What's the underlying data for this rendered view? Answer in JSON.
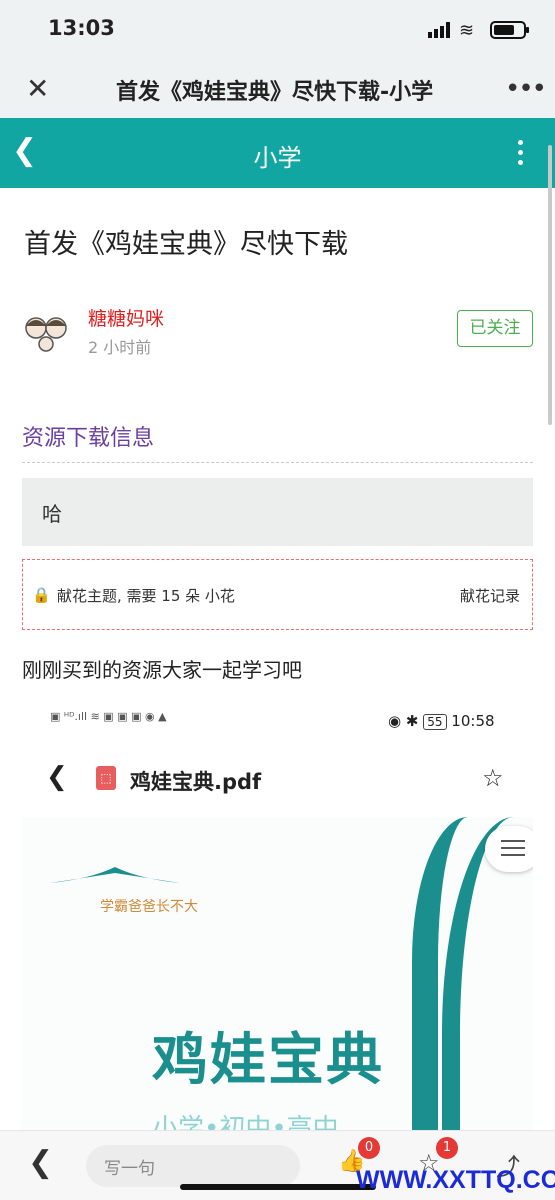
{
  "status_bar": {
    "time": "13:03"
  },
  "nav": {
    "title": "首发《鸡娃宝典》尽快下载-小学",
    "close_icon": "close-icon",
    "more_icon": "more-icon"
  },
  "header": {
    "title": "小学"
  },
  "post": {
    "title": "首发《鸡娃宝典》尽快下载",
    "author": "糖糖妈咪",
    "time_ago": "2 小时前",
    "follow_label": "已关注",
    "section_title": "资源下载信息",
    "hidden_text": "哈",
    "lock_text": "献花主题, 需要 15 朵 小花",
    "lock_record": "献花记录",
    "body_text": "刚刚买到的资源大家一起学习吧"
  },
  "embedded_screenshot": {
    "time": "10:58",
    "battery": "55",
    "file_name": "鸡娃宝典.pdf",
    "slogan": "学霸爸爸长不大",
    "cover_title": "鸡娃宝典",
    "cover_subtitle": "小学•初中•高中"
  },
  "bottom_bar": {
    "comment_placeholder": "写一句",
    "like_count": "0",
    "fav_count": "1"
  },
  "watermark": "WWW.XXTTQ.COM",
  "colors": {
    "teal": "#12a6a3",
    "author": "#e02020",
    "follow": "#4cb050",
    "section": "#6b3fa0",
    "badge": "#e53935"
  }
}
